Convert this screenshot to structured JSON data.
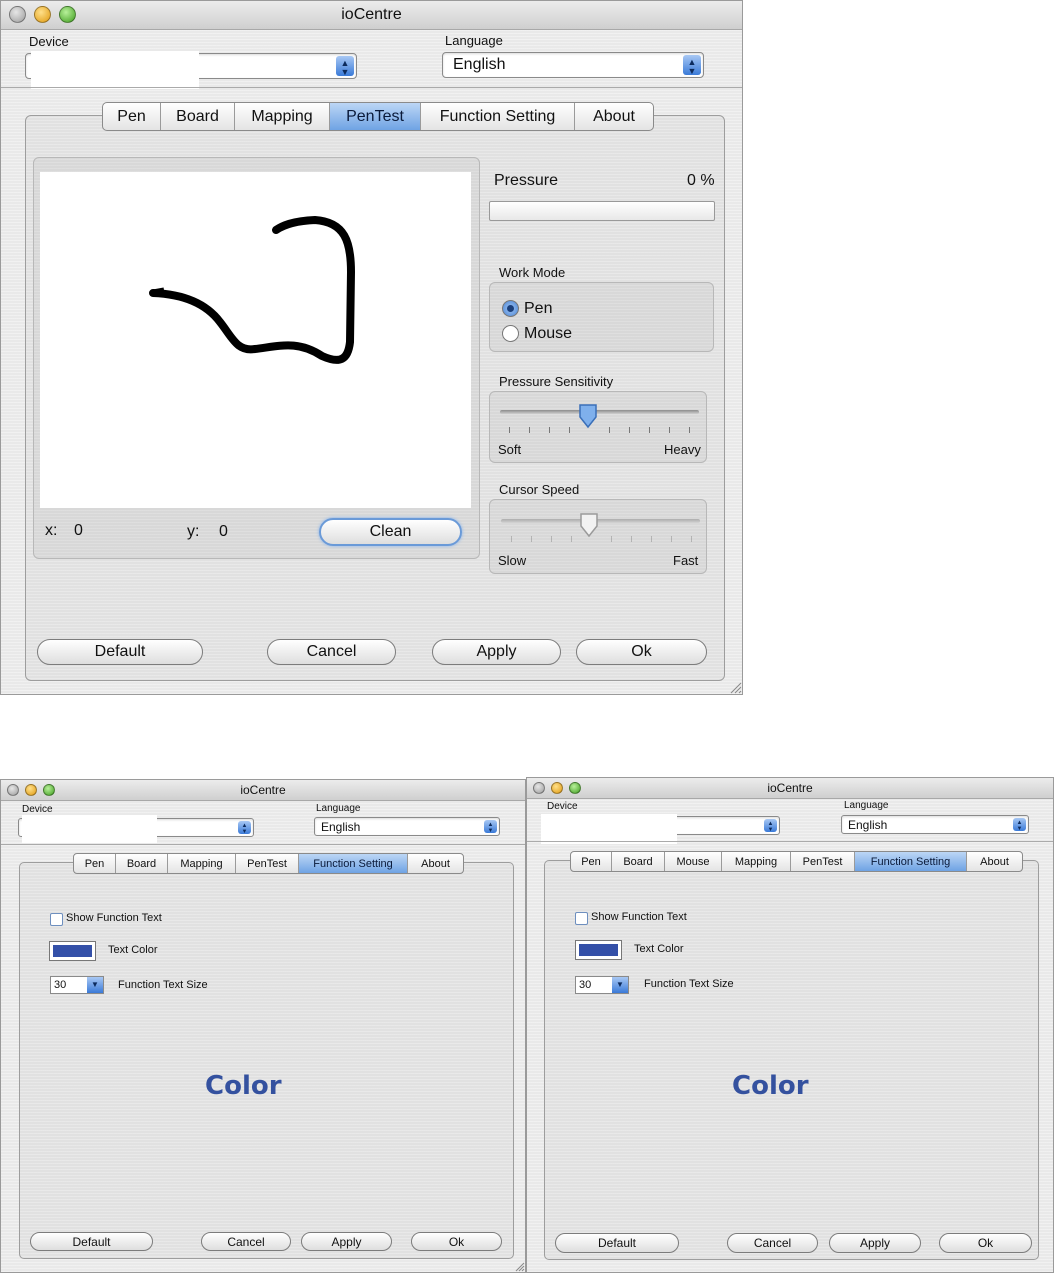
{
  "colors": {
    "accent": "#6fa3e4",
    "text_color_swatch": "#3450a8",
    "color_word": "#34519f"
  },
  "top_window": {
    "title": "ioCentre",
    "device_label": "Device",
    "language_label": "Language",
    "language_value": "English",
    "tabs": [
      "Pen",
      "Board",
      "Mapping",
      "PenTest",
      "Function Setting",
      "About"
    ],
    "active_tab": "PenTest",
    "pressure_label": "Pressure",
    "pressure_value": "0 %",
    "pressure_fraction": 0,
    "work_mode_label": "Work Mode",
    "work_mode_options": [
      "Pen",
      "Mouse"
    ],
    "work_mode_selected": "Pen",
    "pressure_sensitivity_label": "Pressure Sensitivity",
    "pressure_sensitivity_min": "Soft",
    "pressure_sensitivity_max": "Heavy",
    "pressure_sensitivity_level": 0.44,
    "cursor_speed_label": "Cursor Speed",
    "cursor_speed_min": "Slow",
    "cursor_speed_max": "Fast",
    "cursor_speed_level": 0.44,
    "x_label": "x:",
    "x_value": "0",
    "y_label": "y:",
    "y_value": "0",
    "clean_label": "Clean",
    "buttons": {
      "default": "Default",
      "cancel": "Cancel",
      "apply": "Apply",
      "ok": "Ok"
    }
  },
  "bottom_left_window": {
    "title": "ioCentre",
    "device_label": "Device",
    "language_label": "Language",
    "language_value": "English",
    "tabs": [
      "Pen",
      "Board",
      "Mapping",
      "PenTest",
      "Function Setting",
      "About"
    ],
    "active_tab": "Function Setting",
    "show_function_text_label": "Show Function Text",
    "text_color_label": "Text Color",
    "text_size_value": "30",
    "text_size_label": "Function Text Size",
    "color_word": "Color",
    "buttons": {
      "default": "Default",
      "cancel": "Cancel",
      "apply": "Apply",
      "ok": "Ok"
    }
  },
  "bottom_right_window": {
    "title": "ioCentre",
    "device_label": "Device",
    "language_label": "Language",
    "language_value": "English",
    "tabs": [
      "Pen",
      "Board",
      "Mouse",
      "Mapping",
      "PenTest",
      "Function Setting",
      "About"
    ],
    "active_tab": "Function Setting",
    "show_function_text_label": "Show Function Text",
    "text_color_label": "Text Color",
    "text_size_value": "30",
    "text_size_label": "Function Text Size",
    "color_word": "Color",
    "buttons": {
      "default": "Default",
      "cancel": "Cancel",
      "apply": "Apply",
      "ok": "Ok"
    }
  }
}
